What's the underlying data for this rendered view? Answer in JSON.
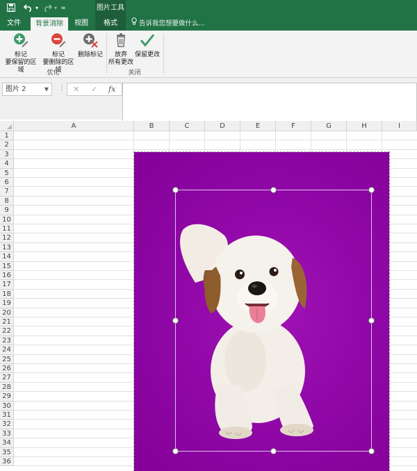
{
  "quick_access": {
    "save_icon": "save-icon",
    "undo_icon": "undo-icon",
    "redo_icon": "redo-icon",
    "customize_icon": "customize-qat-icon"
  },
  "context_tab_label": "图片工具",
  "tabs": [
    {
      "label": "文件"
    },
    {
      "label": "背景消除"
    },
    {
      "label": "视图"
    },
    {
      "label": "格式"
    }
  ],
  "tell_me": "告诉我您想要做什么...",
  "ribbon": {
    "mark_keep": {
      "line1": "标记",
      "line2": "要保留的区域",
      "icon": "plus-pencil-icon"
    },
    "mark_remove": {
      "line1": "标记",
      "line2": "要删除的区域",
      "icon": "minus-pencil-icon"
    },
    "delete_mark": {
      "label": "删除标记",
      "icon": "delete-mark-icon"
    },
    "group_refine": "优化",
    "discard": {
      "line1": "放弃",
      "line2": "所有更改",
      "icon": "trash-icon"
    },
    "keep_changes": {
      "label": "保留更改",
      "icon": "checkmark-icon"
    },
    "group_close": "关闭"
  },
  "name_box": {
    "value": "图片 2"
  },
  "formula_buttons": {
    "cancel": "✕",
    "enter": "✓",
    "function": "fx"
  },
  "formula_value": "",
  "columns": [
    "A",
    "B",
    "C",
    "D",
    "E",
    "F",
    "G",
    "H",
    "I"
  ],
  "rows": [
    "1",
    "2",
    "3",
    "4",
    "5",
    "6",
    "7",
    "8",
    "9",
    "10",
    "11",
    "12",
    "13",
    "14",
    "15",
    "16",
    "17",
    "18",
    "19",
    "20",
    "21",
    "22",
    "23",
    "24",
    "25",
    "26",
    "27",
    "28",
    "29",
    "30",
    "31",
    "32",
    "33",
    "34",
    "35",
    "36"
  ],
  "picture": {
    "name": "dog-photo",
    "background_color": "#8d06a2"
  }
}
